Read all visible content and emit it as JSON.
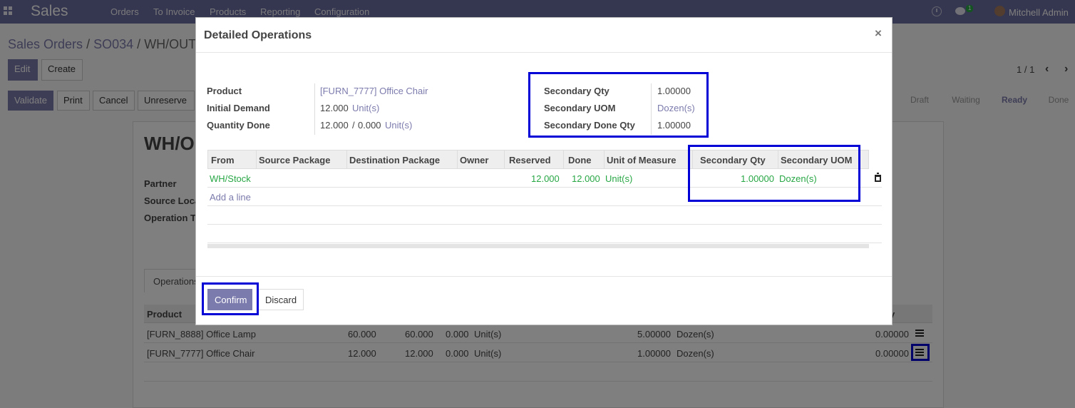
{
  "navbar": {
    "app_name": "Sales",
    "menu": [
      "Orders",
      "To Invoice",
      "Products",
      "Reporting",
      "Configuration"
    ],
    "chat_count": "1",
    "user_name": "Mitchell Admin"
  },
  "breadcrumb": {
    "sales_orders": "Sales Orders",
    "sep": "/",
    "order": "SO034",
    "current": "WH/OUT"
  },
  "buttons": {
    "edit": "Edit",
    "create": "Create",
    "validate": "Validate",
    "print": "Print",
    "cancel": "Cancel",
    "unreserve": "Unreserve"
  },
  "pager": {
    "value": "1 / 1"
  },
  "statusbar": {
    "draft": "Draft",
    "waiting": "Waiting",
    "ready": "Ready",
    "done": "Done"
  },
  "sheet": {
    "title": "WH/O",
    "labels": {
      "partner": "Partner",
      "source_location": "Source Loca",
      "operation_type": "Operation T"
    },
    "tab": "Operations",
    "table_head": {
      "product": "Product",
      "qty_fragment": "y"
    },
    "rows": [
      {
        "product": "[FURN_8888] Office Lamp",
        "demand": "60.000",
        "reserved": "60.000",
        "done": "0.000",
        "uom": "Unit(s)",
        "sec_qty": "5.00000",
        "sec_uom": "Dozen(s)",
        "sec_done": "0.00000"
      },
      {
        "product": "[FURN_7777] Office Chair",
        "demand": "12.000",
        "reserved": "12.000",
        "done": "0.000",
        "uom": "Unit(s)",
        "sec_qty": "1.00000",
        "sec_uom": "Dozen(s)",
        "sec_done": "0.00000"
      }
    ]
  },
  "modal": {
    "title": "Detailed Operations",
    "close": "×",
    "product_label": "Product",
    "product_value": "[FURN_7777] Office Chair",
    "initial_demand_label": "Initial Demand",
    "initial_demand_value": "12.000",
    "initial_demand_uom": "Unit(s)",
    "quantity_done_label": "Quantity Done",
    "quantity_done_value": "12.000",
    "quantity_done_sep": "/",
    "quantity_done_total": "0.000",
    "quantity_done_uom": "Unit(s)",
    "secondary_qty_label": "Secondary Qty",
    "secondary_qty_value": "1.00000",
    "secondary_uom_label": "Secondary UOM",
    "secondary_uom_value": "Dozen(s)",
    "secondary_done_label": "Secondary Done Qty",
    "secondary_done_value": "1.00000",
    "table": {
      "headers": [
        "From",
        "Source Package",
        "Destination Package",
        "Owner",
        "Reserved",
        "Done",
        "Unit of Measure",
        "Secondary Qty",
        "Secondary UOM"
      ],
      "row": {
        "from": "WH/Stock",
        "reserved": "12.000",
        "done": "12.000",
        "uom": "Unit(s)",
        "sec_qty": "1.00000",
        "sec_uom": "Dozen(s)"
      },
      "add_line": "Add a line"
    },
    "confirm": "Confirm",
    "discard": "Discard"
  }
}
